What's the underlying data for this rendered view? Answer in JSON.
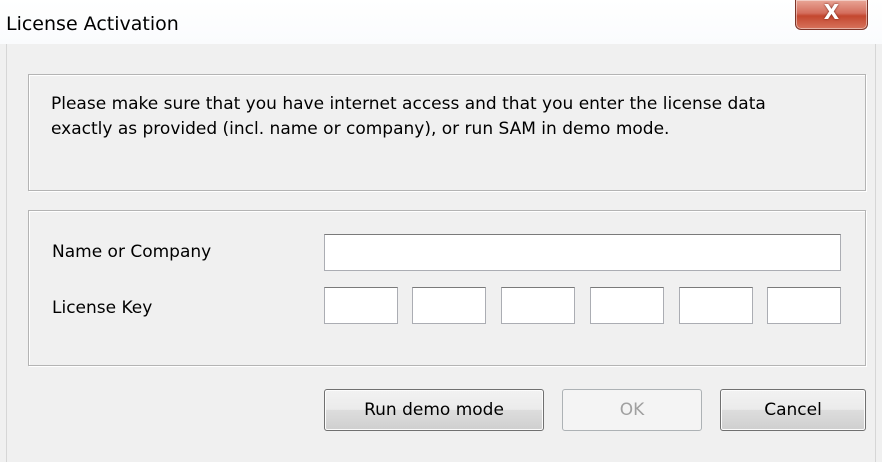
{
  "window": {
    "title": "License Activation",
    "close_label": "X"
  },
  "message": "Please make sure that you have internet access and that you enter the license data exactly as provided (incl. name or company), or run SAM in demo mode.",
  "form": {
    "name_label": "Name or Company",
    "name_value": "",
    "key_label": "License Key",
    "key_segments": [
      "",
      "",
      "",
      "",
      "",
      ""
    ]
  },
  "buttons": {
    "demo": "Run demo mode",
    "ok": "OK",
    "ok_enabled": false,
    "cancel": "Cancel"
  },
  "colors": {
    "close_button": "#c3472f",
    "dialog_background": "#f0f0f0",
    "disabled_text": "#a0a0a0"
  }
}
